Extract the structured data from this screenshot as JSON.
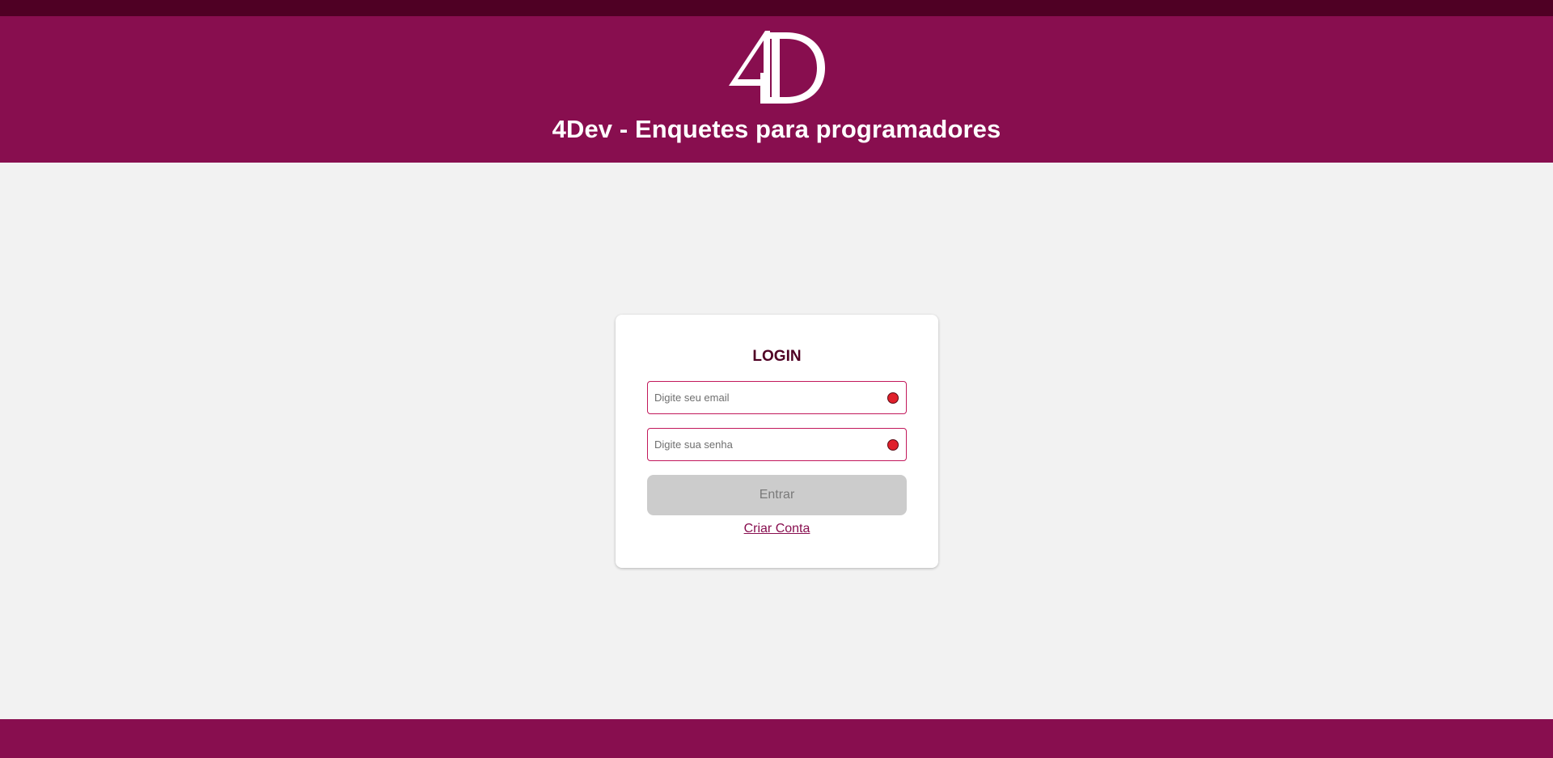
{
  "colors": {
    "primary": "#880e4f",
    "primary_dark": "#4f0024",
    "background": "#f2f2f2",
    "status_error": "#e0202b",
    "button_disabled": "#cccccc"
  },
  "header": {
    "logo_text": "4D",
    "title": "4Dev - Enquetes para programadores"
  },
  "login": {
    "title": "LOGIN",
    "email": {
      "placeholder": "Digite seu email",
      "value": "",
      "status_icon": "error-dot-icon"
    },
    "password": {
      "placeholder": "Digite sua senha",
      "value": "",
      "status_icon": "error-dot-icon"
    },
    "submit_label": "Entrar",
    "signup_link": "Criar Conta"
  }
}
